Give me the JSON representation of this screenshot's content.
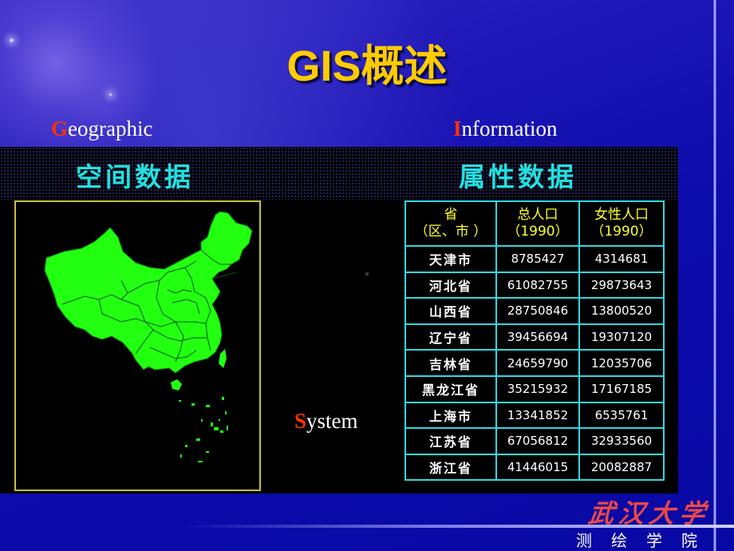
{
  "slide": {
    "title": "GIS概述",
    "acronym_words": [
      {
        "initial": "G",
        "rest": "eographic"
      },
      {
        "initial": "I",
        "rest": "nformation"
      },
      {
        "initial": "S",
        "rest": "ystem"
      }
    ],
    "spatial_heading": "空间数据",
    "attribute_heading": "属性数据",
    "map": {
      "description": "China provincial map",
      "fill_color": "#22ff11",
      "border_color": "#c8c040"
    },
    "table": {
      "headers": [
        {
          "line1": "省",
          "line2": "（区、市 ）"
        },
        {
          "line1": "总人口",
          "line2": "（1990）"
        },
        {
          "line1": "女性人口",
          "line2": "（1990）"
        }
      ],
      "rows": [
        {
          "province": "天津市",
          "total": "8785427",
          "female": "4314681"
        },
        {
          "province": "河北省",
          "total": "61082755",
          "female": "29873643"
        },
        {
          "province": "山西省",
          "total": "28750846",
          "female": "13800520"
        },
        {
          "province": "辽宁省",
          "total": "39456694",
          "female": "19307120"
        },
        {
          "province": "吉林省",
          "total": "24659790",
          "female": "12035706"
        },
        {
          "province": "黑龙江省",
          "total": "35215932",
          "female": "17167185"
        },
        {
          "province": "上海市",
          "total": "13341852",
          "female": "6535761"
        },
        {
          "province": "江苏省",
          "total": "67056812",
          "female": "32933560"
        },
        {
          "province": "浙江省",
          "total": "41446015",
          "female": "20082887"
        }
      ]
    },
    "footer": {
      "university_logo": "武汉大学",
      "department": "测绘学院"
    },
    "colors": {
      "title": "#ffcc00",
      "initial_letter": "#ff3300",
      "heading": "#22e0e0",
      "table_header": "#ffff30",
      "table_grid": "#30d8e0",
      "frame": "#c8c040",
      "logo": "#e84848",
      "background": "#0a0aa8"
    }
  }
}
